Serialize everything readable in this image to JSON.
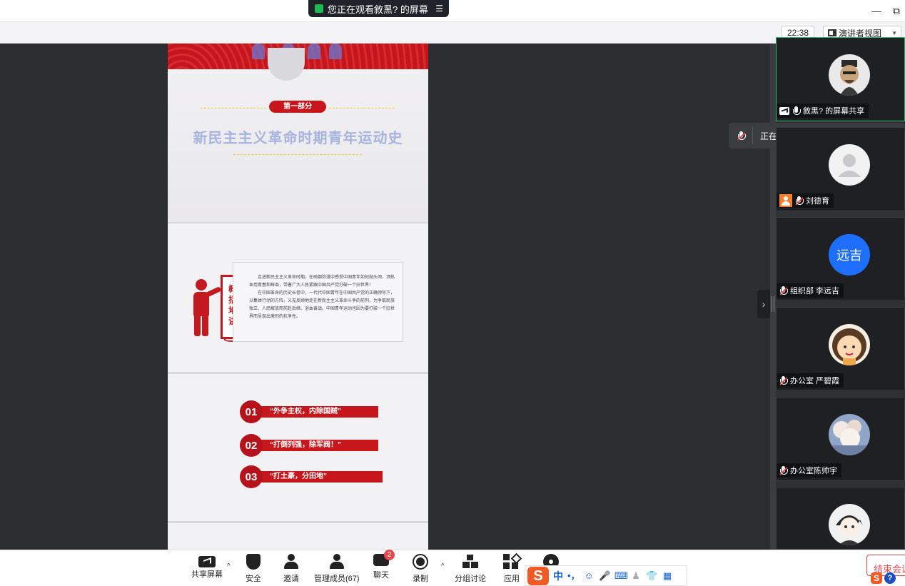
{
  "top_banner": {
    "text": "您正在观看敘黑? 的屏幕"
  },
  "window_controls": {
    "minimize": "—",
    "restore": "⧉"
  },
  "header": {
    "clock": "22:38",
    "view_mode": "演讲者视图"
  },
  "slides": {
    "slide1": {
      "part_label": "第一部分",
      "title": "新民主主义革命时期青年运动史"
    },
    "slide2": {
      "easel_label": [
        "概",
        "括",
        "地",
        "讲"
      ],
      "paragraph1": "走进新民主主义革命时期，在硝烟弥漫中感受中国青年如何抛头颅、洒热血用青春和鲜血，带着广大人民紧跟中国共产党打破一个旧世界！",
      "paragraph2": "在中国革命的历史长卷中，一代代中国青年在中国共产党的正确领导下，以集体行动的方阵，义无反顾地走在新民主主义革命斗争的前列，为争取民族独立、人民解放而前赴后继、浴血奋战。中国青年运动也因为要打破一个旧世界而呈现出激烈的抗争性。"
    },
    "slide3": {
      "points": [
        {
          "num": "01",
          "text": "“外争主权，内除国贼”"
        },
        {
          "num": "02",
          "text": "“打倒列强，除军阀！”"
        },
        {
          "num": "03",
          "text": "“打土豪，分田地”"
        }
      ]
    }
  },
  "speaking_popup": {
    "text": "正在讲话: 敘黑?；"
  },
  "participants": [
    {
      "name": "敘黑? 的屏幕共享",
      "avatar": "cartoon-man-avatar",
      "active": true
    },
    {
      "name": "刘德育",
      "avatar": "default-avatar"
    },
    {
      "name": "组织部 李远吉",
      "avatar_text": "远吉",
      "avatar_color": "#1f6fff"
    },
    {
      "name": "办公室 严碧霞",
      "avatar": "cartoon-girl-avatar"
    },
    {
      "name": "办公室陈帅宇",
      "avatar": "cloud-painting-avatar"
    },
    {
      "name": "",
      "avatar": "anime-boy-avatar"
    }
  ],
  "toolbar": {
    "share": "共享屏幕",
    "security": "安全",
    "invite": "邀请",
    "members": "管理成员(67)",
    "chat": "聊天",
    "chat_badge": "2",
    "record": "录制",
    "breakout": "分组讨论",
    "apps": "应用",
    "end_meeting": "结束会议"
  },
  "ime": {
    "logo": "S",
    "mode": "中",
    "punct": "•，"
  },
  "tray": {
    "sogou": "S",
    "help": "?"
  },
  "colors": {
    "accent_red": "#c8161d",
    "active_green": "#2db46d",
    "badge_red": "#e5484d"
  }
}
